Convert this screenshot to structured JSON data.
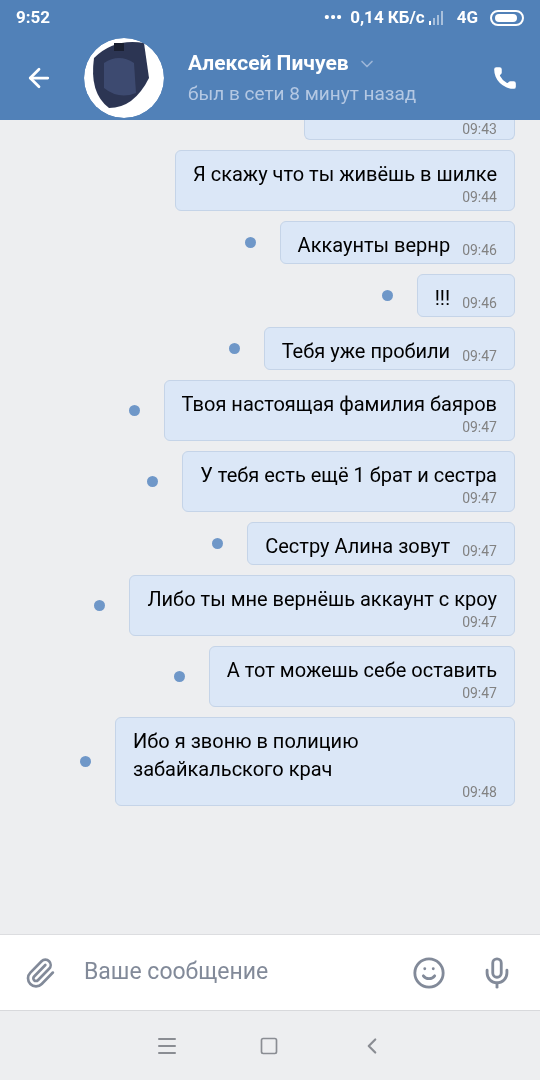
{
  "status_bar": {
    "time": "9:52",
    "dots": "•••",
    "speed": "0,14 КБ/с",
    "network": "4G"
  },
  "header": {
    "name": "Алексей Пичуев",
    "status": "был в сети 8 минут назад"
  },
  "messages": [
    {
      "time": "09:43",
      "unread": false
    },
    {
      "text": "Я скажу что ты живёшь в шилке",
      "time": "09:44",
      "unread": false
    },
    {
      "text": "Аккаунты вернр",
      "time": "09:46",
      "unread": true
    },
    {
      "text": "!!!",
      "time": "09:46",
      "unread": true
    },
    {
      "text": "Тебя уже пробили",
      "time": "09:47",
      "unread": true
    },
    {
      "text": "Твоя настоящая фамилия баяров",
      "time": "09:47",
      "unread": true
    },
    {
      "text": "У тебя есть ещё 1 брат и сестра",
      "time": "09:47",
      "unread": true
    },
    {
      "text": "Сестру Алина зовут",
      "time": "09:47",
      "unread": true
    },
    {
      "text": "Либо ты мне вернёшь аккаунт с кроу",
      "time": "09:47",
      "unread": true
    },
    {
      "text": "А тот можешь себе оставить",
      "time": "09:47",
      "unread": true
    },
    {
      "text": "Ибо я звоню в полицию забайкальского крач",
      "time": "09:48",
      "unread": true
    }
  ],
  "composer": {
    "placeholder": "Ваше сообщение"
  }
}
